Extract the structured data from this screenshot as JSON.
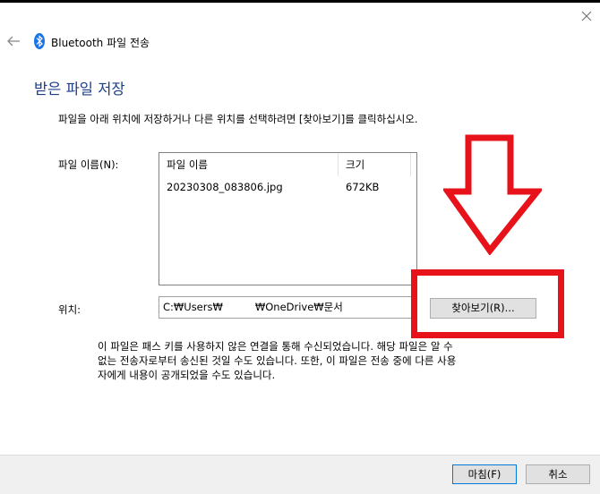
{
  "window": {
    "title": "Bluetooth 파일 전송",
    "back_icon": "back-arrow-icon",
    "close_icon": "close-icon",
    "bluetooth_icon": "bluetooth-icon"
  },
  "page": {
    "heading": "받은 파일 저장",
    "instruction": "파일을 아래 위치에 저장하거나 다른 위치를 선택하려면 [찾아보기]를 클릭하십시오.",
    "file_name_label": "파일 이름(N):",
    "location_label": "위치:"
  },
  "file_list": {
    "columns": [
      "파일 이름",
      "크기"
    ],
    "rows": [
      {
        "name": "20230308_083806.jpg",
        "size": "672KB"
      }
    ]
  },
  "location": {
    "path_start": "C:₩Users₩",
    "path_end": "₩OneDrive₩문서"
  },
  "buttons": {
    "browse": "찾아보기(R)...",
    "finish": "마침(F)",
    "cancel": "취소"
  },
  "notice": "이 파일은 패스 키를 사용하지 않은 연결을 통해 수신되었습니다. 해당 파일은 알 수\n없는 전송자로부터 송신된 것일 수도 있습니다.  또한, 이 파일은 전송 중에 다른 사용\n자에게 내용이 공개되었을 수도 있습니다.",
  "colors": {
    "heading": "#1c3e87",
    "annotation_red": "#e8131a",
    "bluetooth_blue": "#1a73e8",
    "button_face": "#e1e1e1",
    "default_button_border": "#0078d7"
  }
}
